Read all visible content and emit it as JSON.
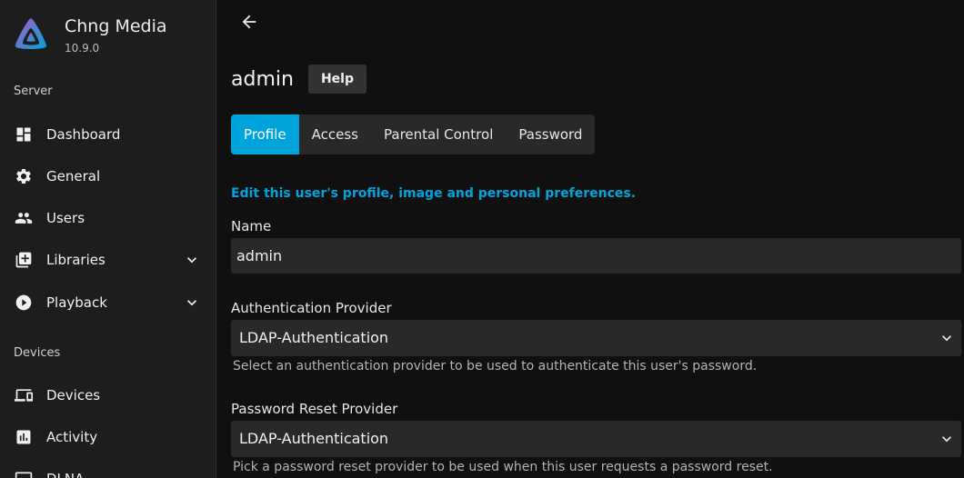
{
  "brand": {
    "name": "Chng Media",
    "version": "10.9.0"
  },
  "sidebar": {
    "sections": [
      {
        "label": "Server",
        "items": [
          {
            "label": "Dashboard",
            "icon": "dashboard-icon"
          },
          {
            "label": "General",
            "icon": "gear-icon"
          },
          {
            "label": "Users",
            "icon": "users-icon"
          },
          {
            "label": "Libraries",
            "icon": "library-add-icon",
            "expandable": true
          },
          {
            "label": "Playback",
            "icon": "play-circle-icon",
            "expandable": true
          }
        ]
      },
      {
        "label": "Devices",
        "items": [
          {
            "label": "Devices",
            "icon": "devices-icon"
          },
          {
            "label": "Activity",
            "icon": "activity-chart-icon"
          },
          {
            "label": "DLNA",
            "icon": "dlna-icon"
          }
        ]
      }
    ]
  },
  "header": {
    "back_icon": "arrow-back-icon",
    "title": "admin",
    "help_label": "Help"
  },
  "tabs": [
    {
      "label": "Profile",
      "active": true
    },
    {
      "label": "Access",
      "active": false
    },
    {
      "label": "Parental Control",
      "active": false
    },
    {
      "label": "Password",
      "active": false
    }
  ],
  "form": {
    "intro": "Edit this user's profile, image and personal preferences.",
    "name": {
      "label": "Name",
      "value": "admin"
    },
    "auth_provider": {
      "label": "Authentication Provider",
      "value": "LDAP-Authentication",
      "help": "Select an authentication provider to be used to authenticate this user's password."
    },
    "reset_provider": {
      "label": "Password Reset Provider",
      "value": "LDAP-Authentication",
      "help": "Pick a password reset provider to be used when this user requests a password reset."
    }
  },
  "colors": {
    "accent": "#00a4dc",
    "sidebar_bg": "#1d1d1d",
    "page_bg": "#101010",
    "input_bg": "#292929"
  }
}
